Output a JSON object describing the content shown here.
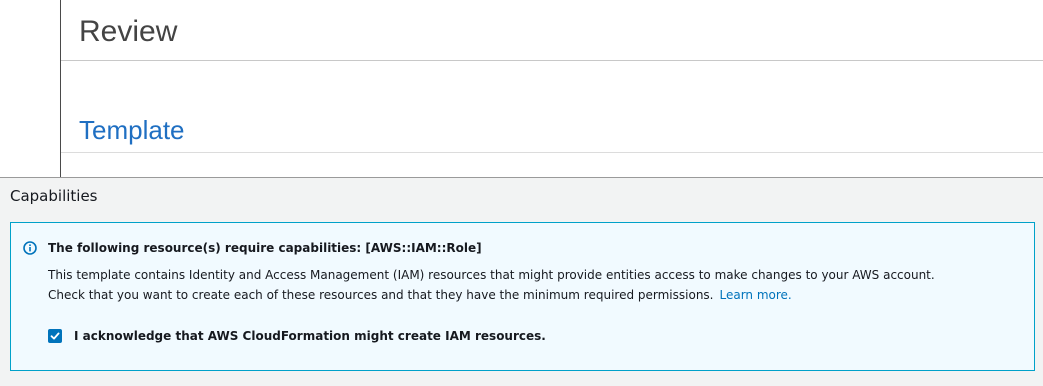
{
  "review": {
    "title": "Review"
  },
  "template": {
    "title": "Template"
  },
  "capabilities": {
    "heading": "Capabilities",
    "alert": {
      "icon": "info-icon",
      "title": "The following resource(s) require capabilities: [AWS::IAM::Role]",
      "body_line_1": "This template contains Identity and Access Management (IAM) resources that might provide entities access to make changes to your AWS account.",
      "body_line_2": "Check that you want to create each of these resources and that they have the minimum required permissions.",
      "learn_more": "Learn more."
    },
    "acknowledge": {
      "checked": true,
      "label": "I acknowledge that AWS CloudFormation might create IAM resources."
    }
  },
  "colors": {
    "link_blue": "#0073bb",
    "heading_blue": "#1f6fc2",
    "alert_border": "#00a1c9",
    "alert_background": "#f1faff",
    "panel_background": "#f2f3f3"
  }
}
